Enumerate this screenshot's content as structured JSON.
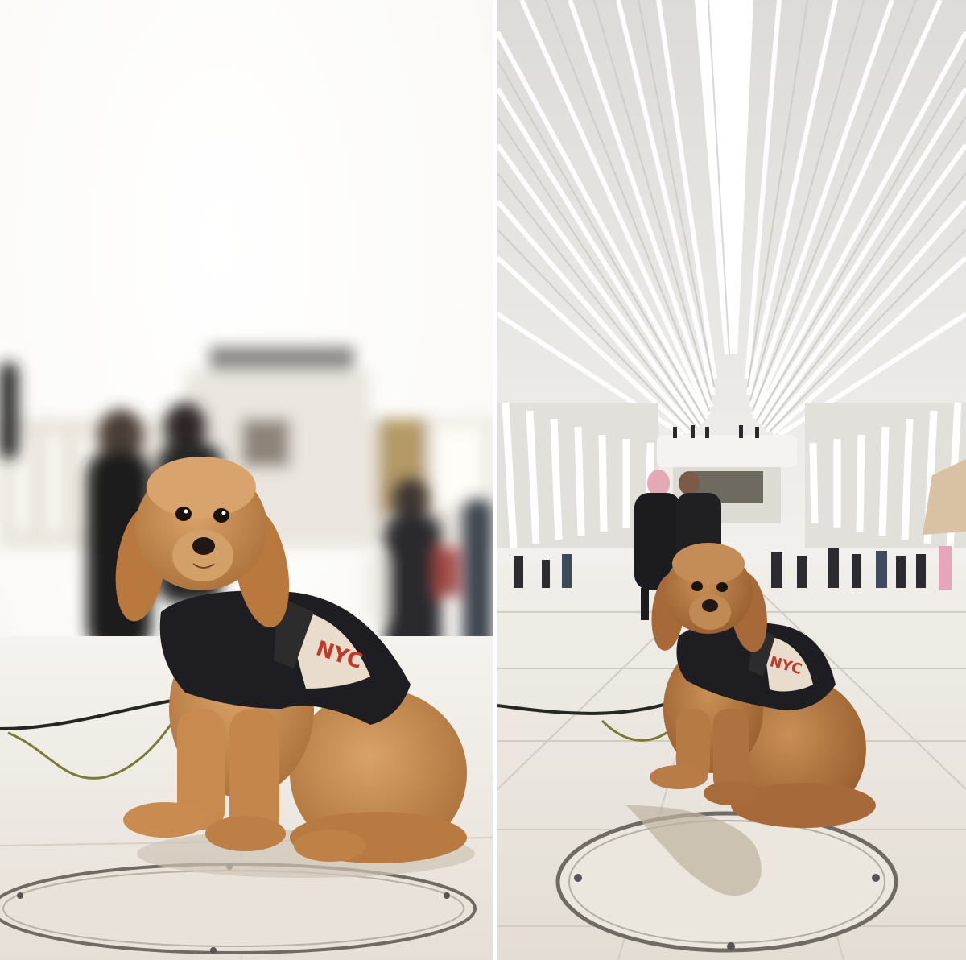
{
  "image": {
    "panels": [
      {
        "name": "left-photo",
        "dog_sweater_text": "NYC"
      },
      {
        "name": "right-photo",
        "dog_sweater_text": "NYC"
      }
    ],
    "colors": {
      "dog_fur": "#c78a4e",
      "sweater": "#1d1d22",
      "sweater_panel": "#e9dccd",
      "sweater_logo": "#c0392b",
      "leash": "#5a5a2a",
      "ceiling_white": "#f4f4f2",
      "floor": "#e7e3dc"
    }
  }
}
